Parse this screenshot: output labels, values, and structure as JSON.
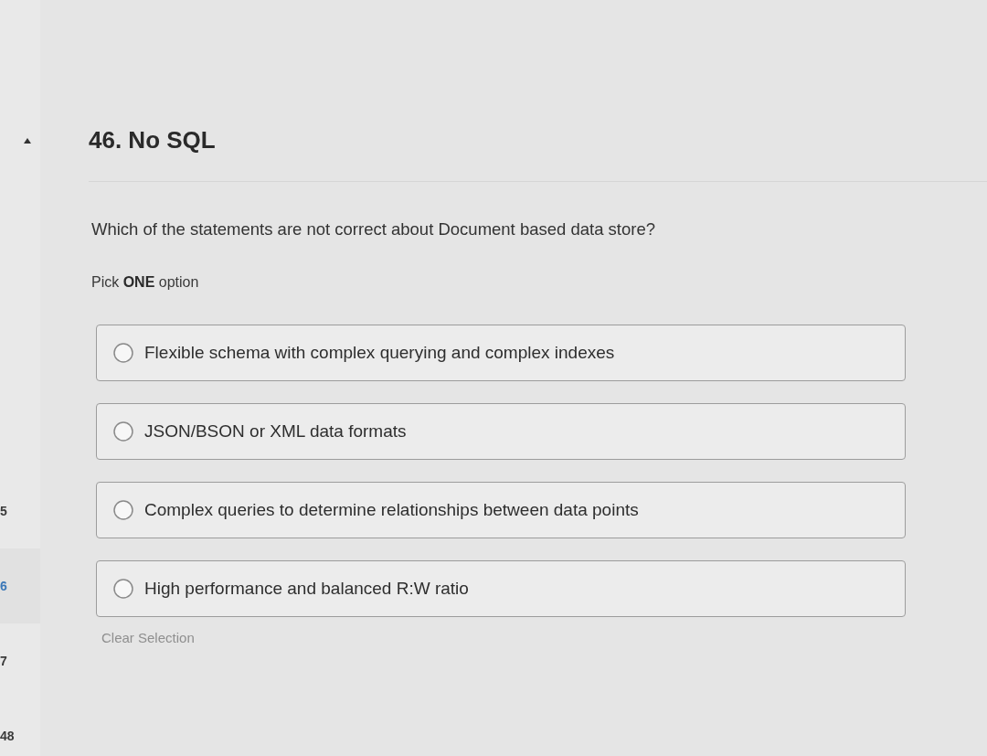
{
  "sidebar": {
    "items": [
      {
        "label": "5",
        "selected": false
      },
      {
        "label": "6",
        "selected": true
      },
      {
        "label": "7",
        "selected": false
      },
      {
        "label": "48",
        "selected": false
      }
    ]
  },
  "question": {
    "title": "46. No SQL",
    "text": "Which of the statements are not correct about Document based data store?",
    "instruction": "Pick **ONE** option"
  },
  "options": [
    {
      "label": "Flexible schema with complex querying and complex indexes",
      "selected": false
    },
    {
      "label": "JSON/BSON or XML data formats",
      "selected": false
    },
    {
      "label": "Complex queries to determine relationships between data points",
      "selected": false
    },
    {
      "label": "High performance and balanced R:W ratio",
      "selected": false
    }
  ],
  "clear_selection": {
    "label": "Clear Selection",
    "disabled": true
  }
}
